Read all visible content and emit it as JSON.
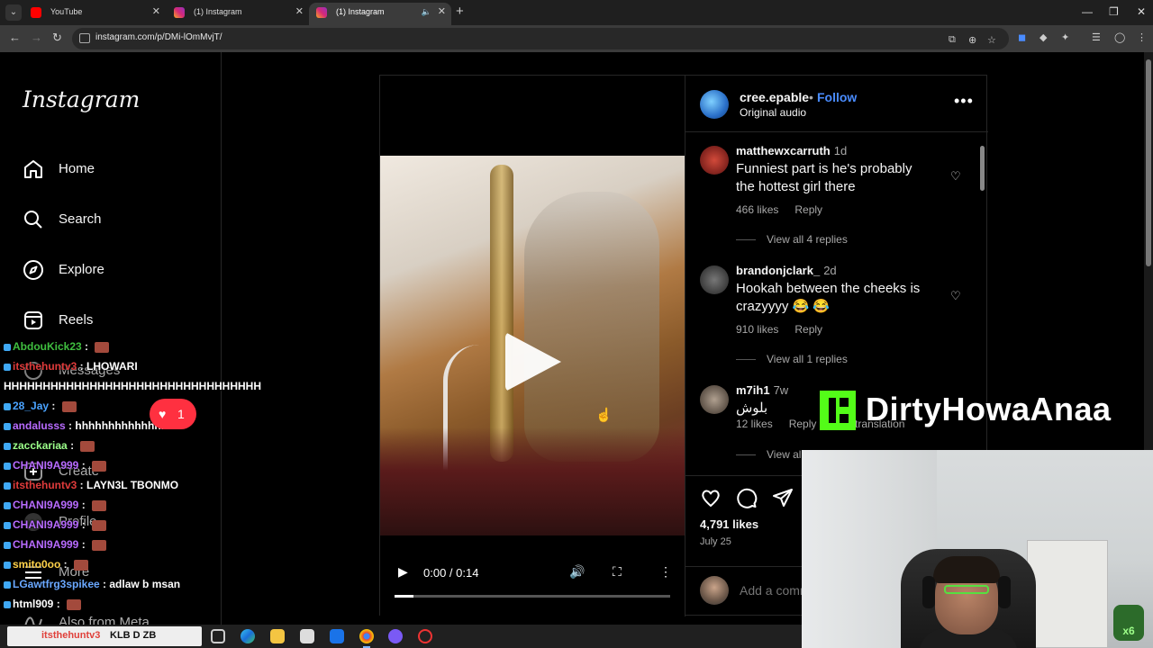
{
  "browser": {
    "tabs": [
      {
        "title": "YouTube",
        "active": false,
        "color": "#ff0000"
      },
      {
        "title": "(1) Instagram",
        "active": false,
        "color": "#d62976"
      },
      {
        "title": "(1) Instagram",
        "active": true,
        "color": "#d62976"
      }
    ],
    "url": "instagram.com/p/DMi-lOmMvjT/"
  },
  "sidebar": {
    "logo": "Instagram",
    "items": [
      {
        "label": "Home",
        "icon": "home-icon"
      },
      {
        "label": "Search",
        "icon": "search-icon"
      },
      {
        "label": "Explore",
        "icon": "compass-icon"
      },
      {
        "label": "Reels",
        "icon": "reels-icon"
      },
      {
        "label": "Messages",
        "icon": "messages-icon"
      },
      {
        "label": "Create",
        "icon": "plus-icon"
      },
      {
        "label": "Profile",
        "icon": "profile-icon"
      },
      {
        "label": "More",
        "icon": "menu-icon"
      },
      {
        "label": "Also from Meta",
        "icon": "meta-icon"
      }
    ],
    "notification_count": "1"
  },
  "post": {
    "author": "cree.epable",
    "separator": "•",
    "follow_label": "Follow",
    "audio": "Original audio",
    "video": {
      "time": "0:00 / 0:14",
      "progress": 0.07
    },
    "comments": [
      {
        "user": "matthewxcarruth",
        "age": "1d",
        "text": "Funniest part is he's probably the hottest girl there",
        "likes": "466 likes",
        "reply": "Reply",
        "view_replies": "View all 4 replies"
      },
      {
        "user": "brandonjclark_",
        "age": "2d",
        "text": "Hookah between the cheeks is crazyyyy 😂 😂",
        "likes": "910 likes",
        "reply": "Reply",
        "view_replies": "View all 1 replies"
      },
      {
        "user": "m7ih1",
        "age": "7w",
        "text": "بلوش",
        "likes": "12 likes",
        "reply": "Reply",
        "see_translation": "See translation",
        "view_replies": "View all"
      }
    ],
    "likes": "4,791 likes",
    "date": "July 25",
    "add_comment_placeholder": "Add a comment..."
  },
  "stream_chat": [
    {
      "user": "AbdouKick23",
      "msg": "",
      "color": "#3fbf3f",
      "emote": true
    },
    {
      "user": "itsthehuntv3",
      "msg": "LHOWARI",
      "color": "#e03b3b",
      "emote": false
    },
    {
      "user": "",
      "msg": "HHHHHHHHHHHHHHHHHHHHHHHHHHHHHHHHH",
      "color": "#ffffff",
      "emote": false
    },
    {
      "user": "28_Jay",
      "msg": "",
      "color": "#4aa3ff",
      "emote": true
    },
    {
      "user": "andalusss",
      "msg": "hhhhhhhhhhhhhhhh",
      "color": "#b86bff",
      "emote": false
    },
    {
      "user": "zacckariaa",
      "msg": "",
      "color": "#9cff8a",
      "emote": true
    },
    {
      "user": "CHANI9A999",
      "msg": "",
      "color": "#b86bff",
      "emote": true
    },
    {
      "user": "itsthehuntv3",
      "msg": "LAYN3L TBONMO",
      "color": "#e03b3b",
      "emote": false
    },
    {
      "user": "CHANI9A999",
      "msg": "",
      "color": "#b86bff",
      "emote": true
    },
    {
      "user": "CHANI9A999",
      "msg": "",
      "color": "#b86bff",
      "emote": true
    },
    {
      "user": "CHANI9A999",
      "msg": "",
      "color": "#b86bff",
      "emote": true
    },
    {
      "user": "smito0oo",
      "msg": "",
      "color": "#ffd24a",
      "emote": true
    },
    {
      "user": "LGawtfrg3spikee",
      "msg": "adlaw b msan",
      "color": "#6aa8ff",
      "emote": false
    },
    {
      "user": "html909",
      "msg": "",
      "color": "#ffffff",
      "emote": true
    }
  ],
  "stream": {
    "channel": "DirtyHowaAnaa",
    "brand_color": "#53fc18",
    "cam_badge": "x6"
  },
  "taskbar": {
    "search_user": "itsthehuntv3",
    "search_text": "KLB D ZB"
  }
}
